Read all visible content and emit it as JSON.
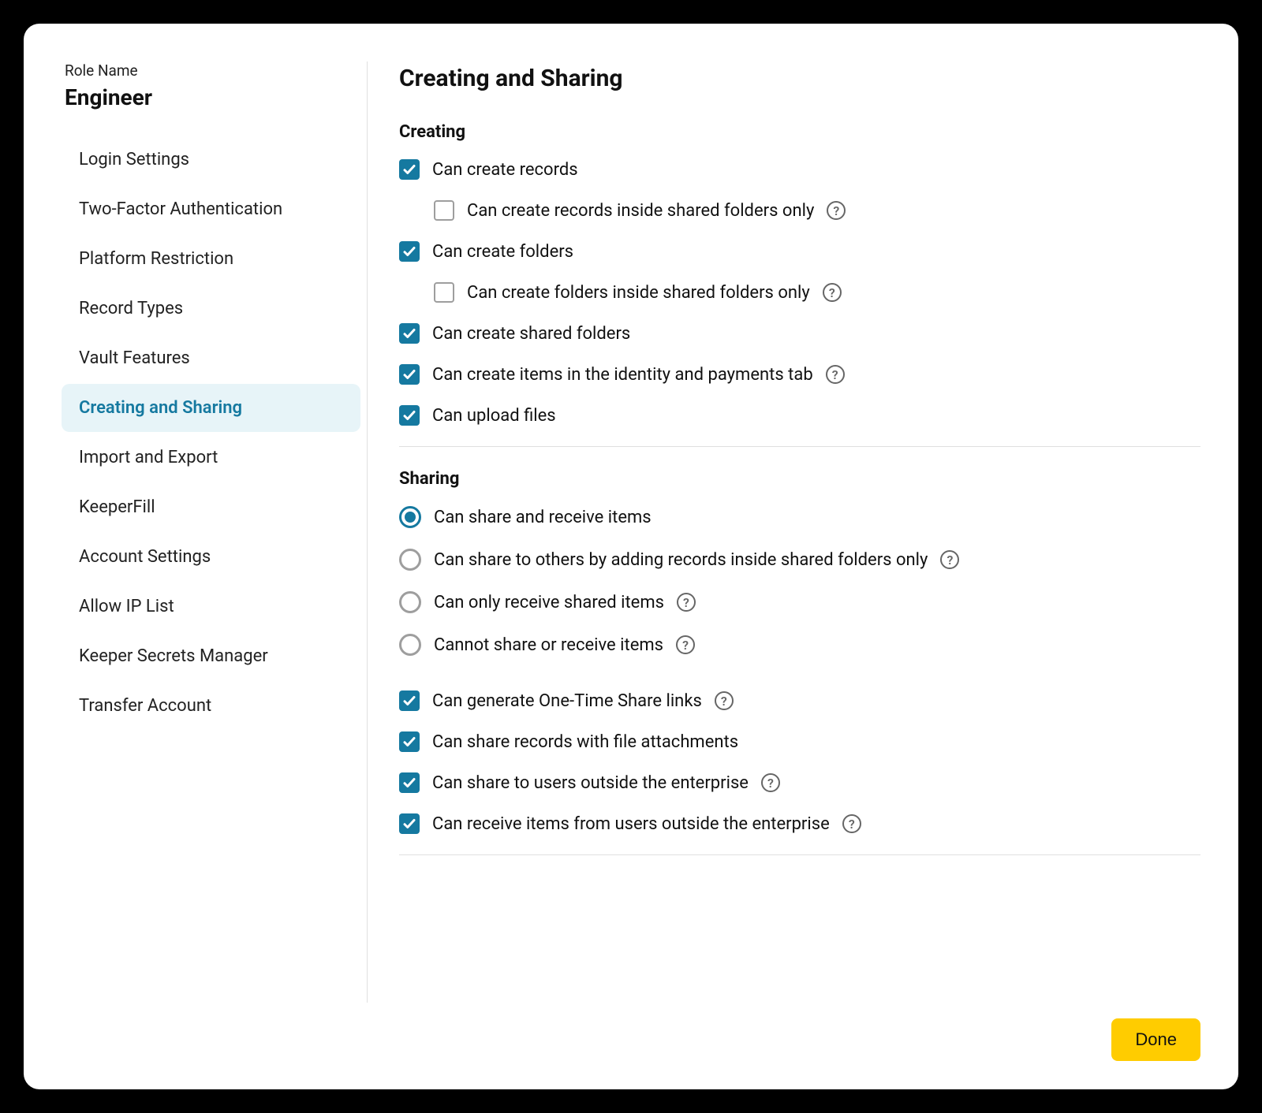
{
  "sidebar": {
    "role_label": "Role Name",
    "role_name": "Engineer",
    "items": [
      {
        "label": "Login Settings",
        "active": false
      },
      {
        "label": "Two-Factor Authentication",
        "active": false
      },
      {
        "label": "Platform Restriction",
        "active": false
      },
      {
        "label": "Record Types",
        "active": false
      },
      {
        "label": "Vault Features",
        "active": false
      },
      {
        "label": "Creating and Sharing",
        "active": true
      },
      {
        "label": "Import and Export",
        "active": false
      },
      {
        "label": "KeeperFill",
        "active": false
      },
      {
        "label": "Account Settings",
        "active": false
      },
      {
        "label": "Allow IP List",
        "active": false
      },
      {
        "label": "Keeper Secrets Manager",
        "active": false
      },
      {
        "label": "Transfer Account",
        "active": false
      }
    ]
  },
  "main": {
    "title": "Creating and Sharing",
    "creating_section": "Creating",
    "sharing_section": "Sharing",
    "creating": [
      {
        "label": "Can create records",
        "checked": true,
        "help": false,
        "indent": false
      },
      {
        "label": "Can create records inside shared folders only",
        "checked": false,
        "help": true,
        "indent": true
      },
      {
        "label": "Can create folders",
        "checked": true,
        "help": false,
        "indent": false
      },
      {
        "label": "Can create folders inside shared folders only",
        "checked": false,
        "help": true,
        "indent": true
      },
      {
        "label": "Can create shared folders",
        "checked": true,
        "help": false,
        "indent": false
      },
      {
        "label": "Can create items in the identity and payments tab",
        "checked": true,
        "help": true,
        "indent": false
      },
      {
        "label": "Can upload files",
        "checked": true,
        "help": false,
        "indent": false
      }
    ],
    "sharing_radio": [
      {
        "label": "Can share and receive items",
        "selected": true,
        "help": false
      },
      {
        "label": "Can share to others by adding records inside shared folders only",
        "selected": false,
        "help": true
      },
      {
        "label": "Can only receive shared items",
        "selected": false,
        "help": true
      },
      {
        "label": "Cannot share or receive items",
        "selected": false,
        "help": true
      }
    ],
    "sharing_checks": [
      {
        "label": "Can generate One-Time Share links",
        "checked": true,
        "help": true
      },
      {
        "label": "Can share records with file attachments",
        "checked": true,
        "help": false
      },
      {
        "label": "Can share to users outside the enterprise",
        "checked": true,
        "help": true
      },
      {
        "label": "Can receive items from users outside the enterprise",
        "checked": true,
        "help": true
      }
    ]
  },
  "footer": {
    "done_label": "Done"
  }
}
